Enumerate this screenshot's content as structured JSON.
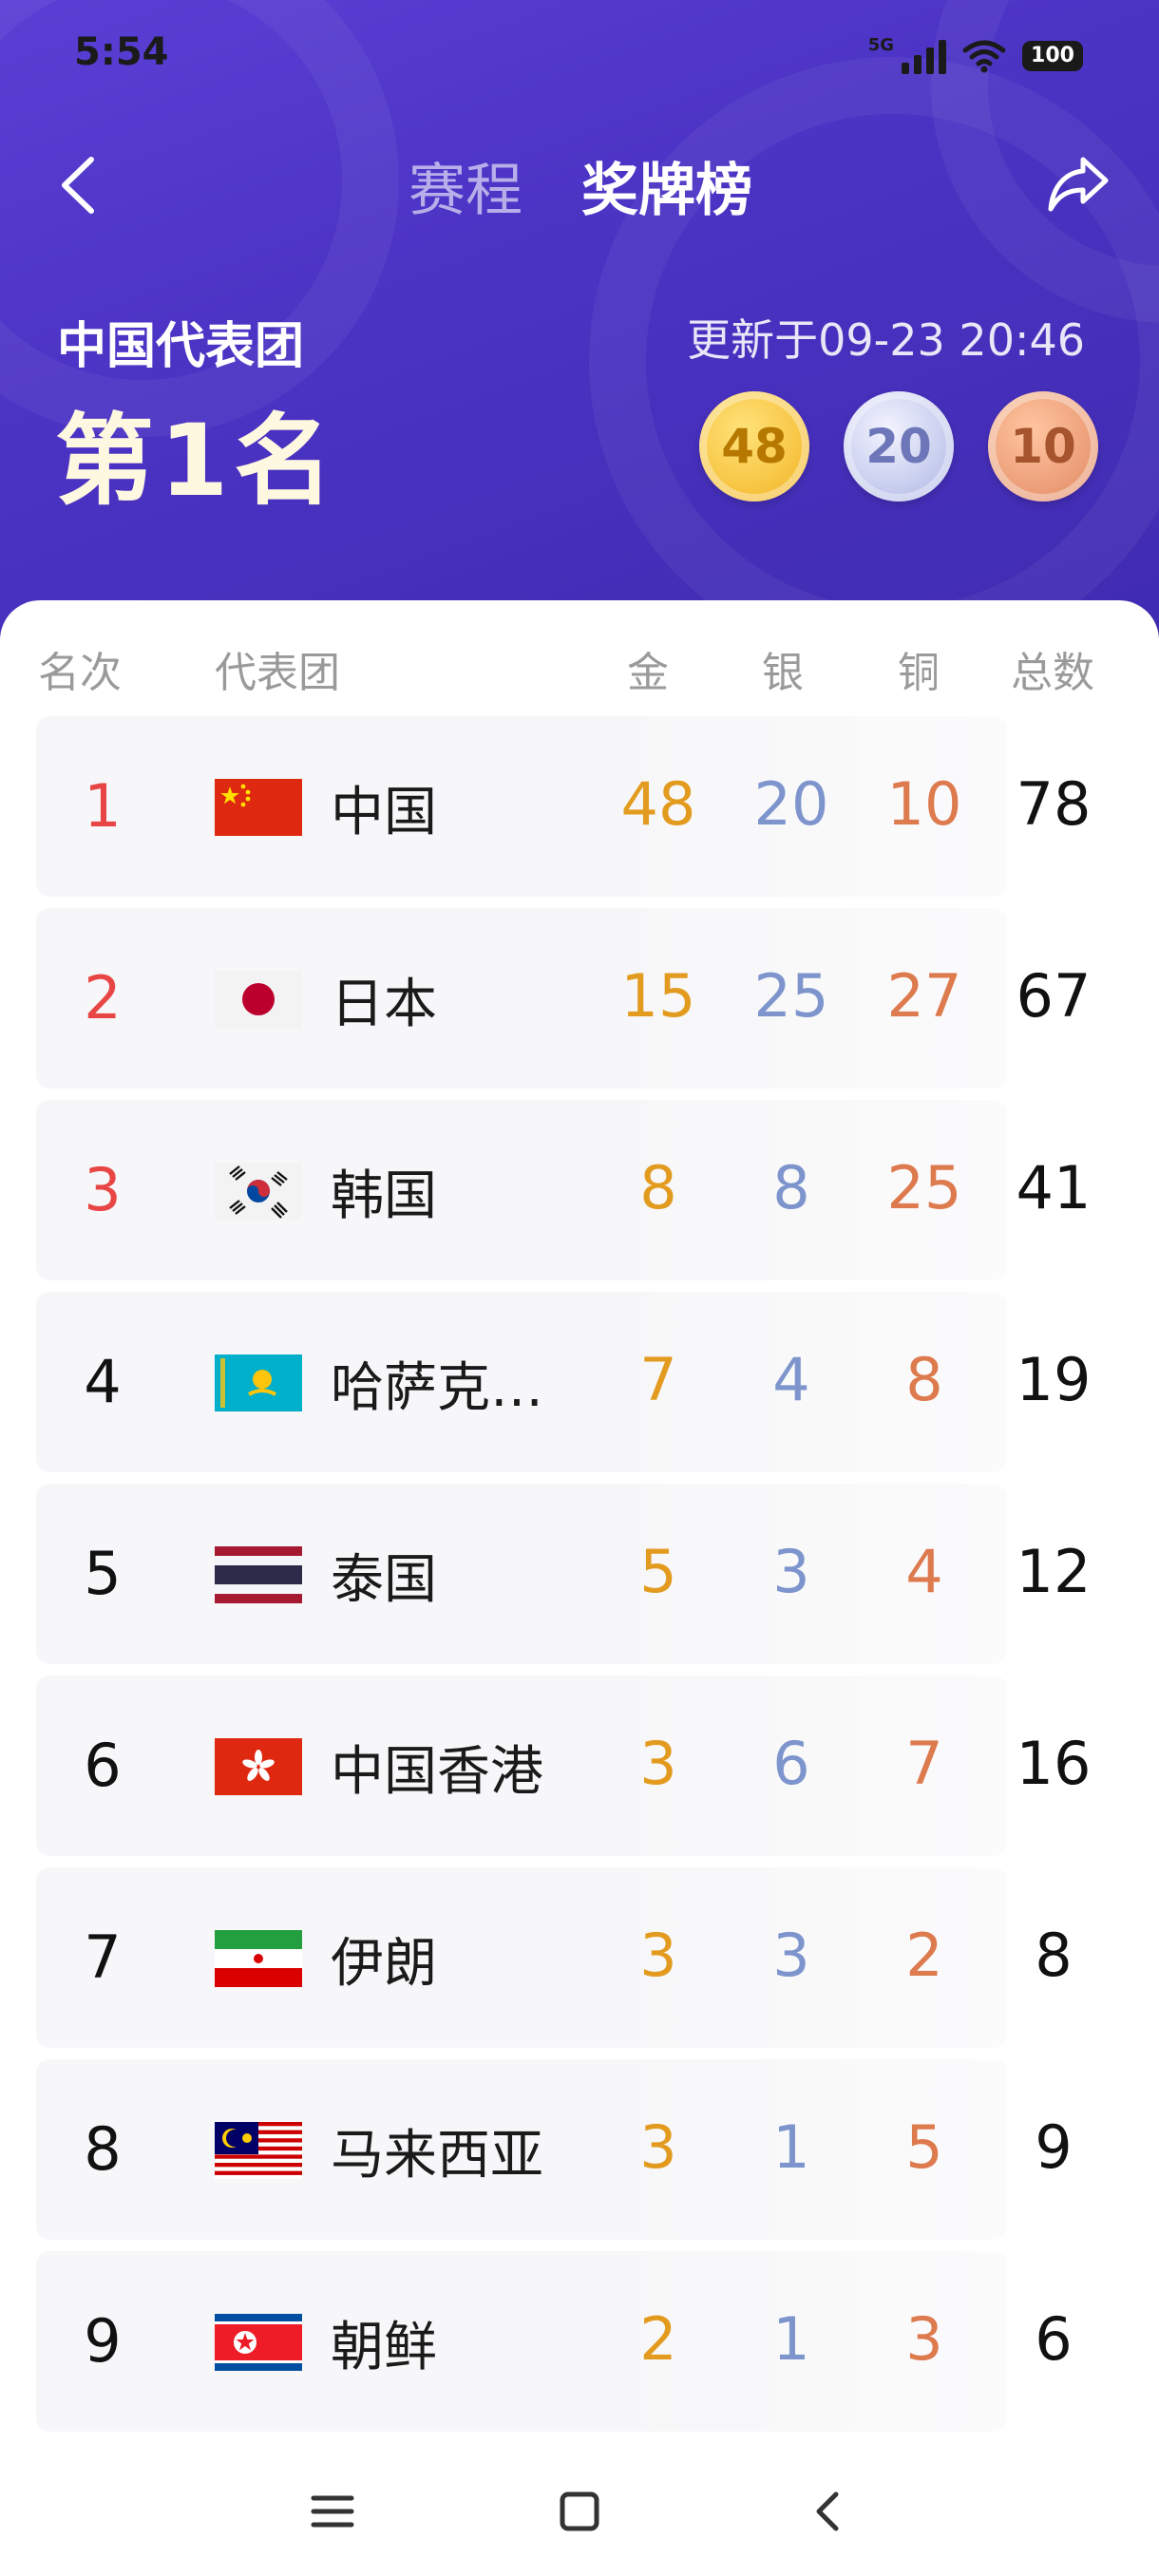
{
  "status": {
    "time": "5:54",
    "network": "5G",
    "battery": "100"
  },
  "nav": {
    "tab_schedule": "赛程",
    "tab_medals": "奖牌榜"
  },
  "summary": {
    "team_name": "中国代表团",
    "rank_text": "第1名",
    "updated": "更新于09-23 20:46",
    "gold": "48",
    "silver": "20",
    "bronze": "10"
  },
  "table": {
    "headers": {
      "rank": "名次",
      "team": "代表团",
      "gold": "金",
      "silver": "银",
      "bronze": "铜",
      "total": "总数"
    },
    "rows": [
      {
        "rank": "1",
        "country": "中国",
        "flag": "china-flag",
        "gold": "48",
        "silver": "20",
        "bronze": "10",
        "total": "78"
      },
      {
        "rank": "2",
        "country": "日本",
        "flag": "japan-flag",
        "gold": "15",
        "silver": "25",
        "bronze": "27",
        "total": "67"
      },
      {
        "rank": "3",
        "country": "韩国",
        "flag": "south-korea-flag",
        "gold": "8",
        "silver": "8",
        "bronze": "25",
        "total": "41"
      },
      {
        "rank": "4",
        "country": "哈萨克…",
        "flag": "kazakhstan-flag",
        "gold": "7",
        "silver": "4",
        "bronze": "8",
        "total": "19"
      },
      {
        "rank": "5",
        "country": "泰国",
        "flag": "thailand-flag",
        "gold": "5",
        "silver": "3",
        "bronze": "4",
        "total": "12"
      },
      {
        "rank": "6",
        "country": "中国香港",
        "flag": "hong-kong-flag",
        "gold": "3",
        "silver": "6",
        "bronze": "7",
        "total": "16"
      },
      {
        "rank": "7",
        "country": "伊朗",
        "flag": "iran-flag",
        "gold": "3",
        "silver": "3",
        "bronze": "2",
        "total": "8"
      },
      {
        "rank": "8",
        "country": "马来西亚",
        "flag": "malaysia-flag",
        "gold": "3",
        "silver": "1",
        "bronze": "5",
        "total": "9"
      },
      {
        "rank": "9",
        "country": "朝鲜",
        "flag": "north-korea-flag",
        "gold": "2",
        "silver": "1",
        "bronze": "3",
        "total": "6"
      }
    ]
  },
  "colors": {
    "header_bg": "#4b33c4",
    "gold_text": "#e39b1f",
    "silver_text": "#7d95cc",
    "bronze_text": "#dd7a4e",
    "top_rank": "#e84545"
  }
}
